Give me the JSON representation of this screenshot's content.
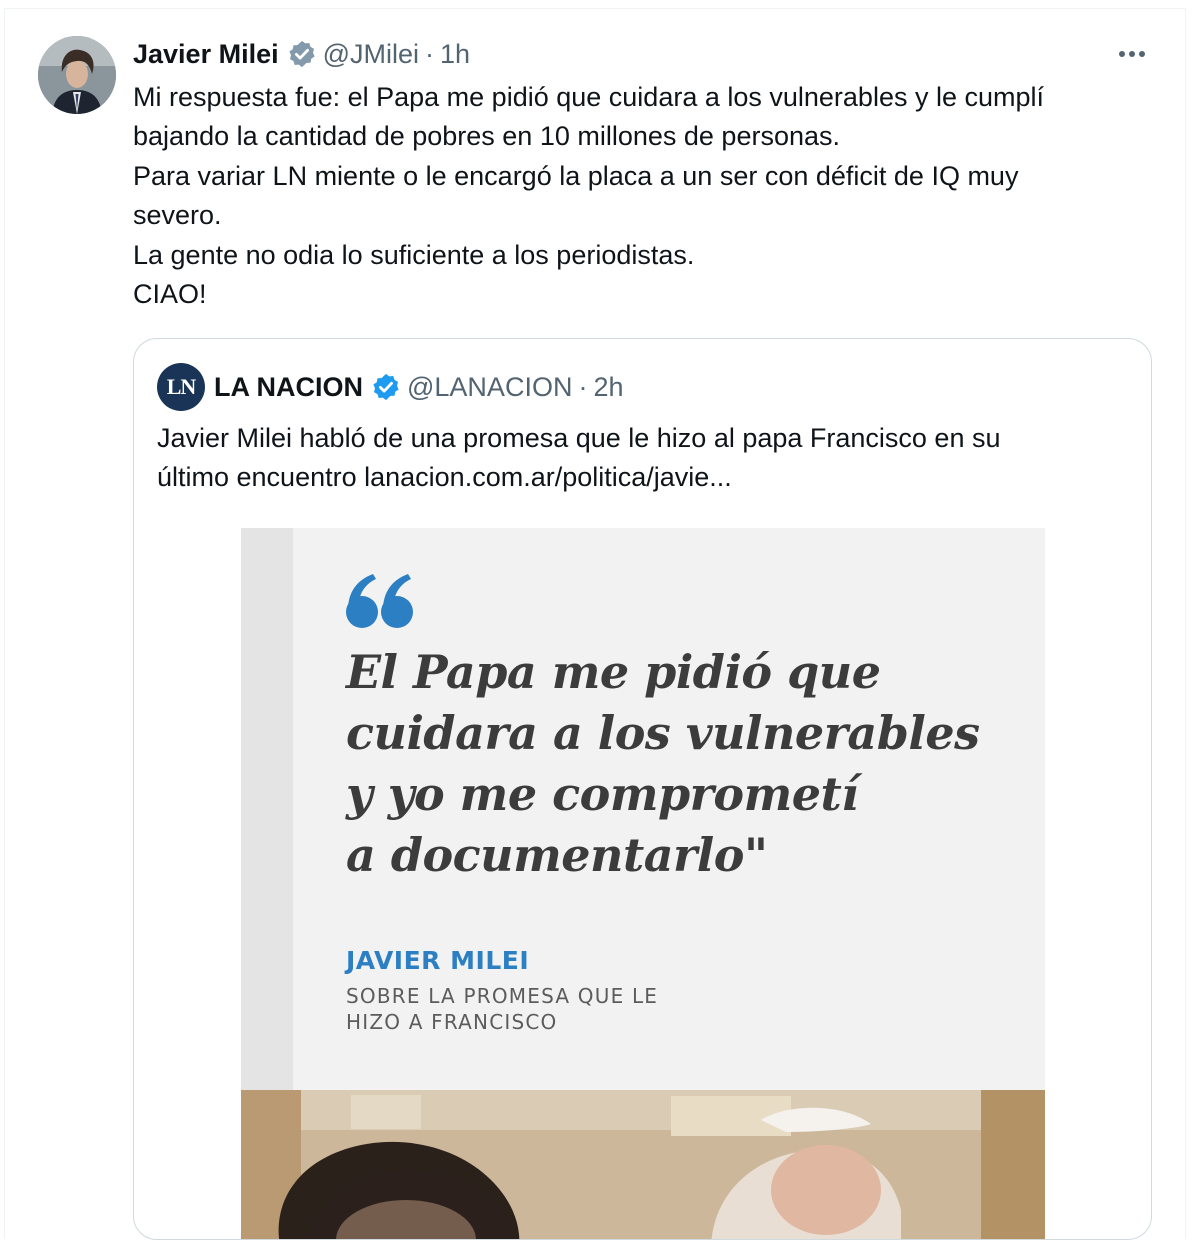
{
  "tweet": {
    "author_name": "Javier Milei",
    "handle": "@JMilei",
    "separator": "·",
    "time": "1h",
    "text_lines": [
      "Mi respuesta fue: el Papa me pidió que cuidara a los vulnerables y le cumplí",
      "bajando la cantidad de pobres en 10 millones de personas.",
      "Para variar LN miente o le encargó la placa a un ser con déficit de IQ muy",
      "severo.",
      "La gente no odia lo suficiente a los periodistas.",
      "CIAO!"
    ]
  },
  "quoted": {
    "logo_text": "LN",
    "author_name": "LA NACION",
    "handle": "@LANACION",
    "separator": "·",
    "time": "2h",
    "text_lines": [
      "Javier Milei habló de una promesa que le hizo al papa Francisco en su",
      "último encuentro lanacion.com.ar/politica/javie..."
    ],
    "media": {
      "quote_lines": [
        "El Papa me pidió que",
        "cuidara a los vulnerables",
        "y yo me comprometí",
        "a documentarlo\""
      ],
      "attribution_name": "JAVIER MILEI",
      "attribution_sub": [
        "SOBRE LA PROMESA QUE LE",
        "HIZO A FRANCISCO"
      ]
    }
  },
  "icons": {
    "verified_author": "verified-badge-gray-icon",
    "verified_quoted": "verified-badge-blue-icon",
    "more": "more-options-icon",
    "quote_mark": "quote-mark-icon"
  },
  "colors": {
    "text_primary": "#0f1419",
    "text_secondary": "#536471",
    "verified_gray": "#829aab",
    "verified_blue": "#1d9bf0",
    "quote_accent": "#2b7fc2",
    "ln_logo_bg": "#1a3457"
  }
}
